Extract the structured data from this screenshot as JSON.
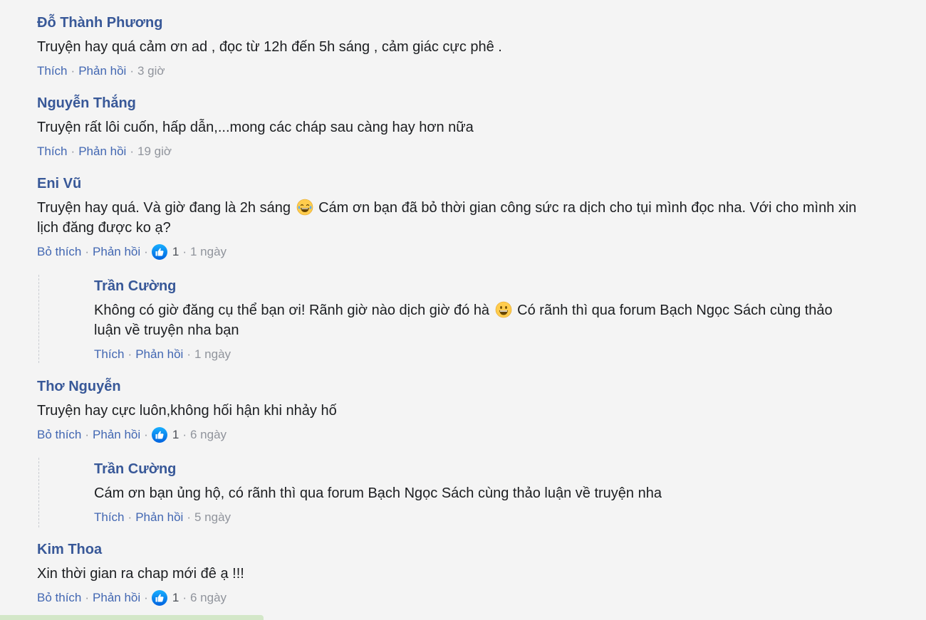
{
  "comments": [
    {
      "author": "Đỗ Thành Phương",
      "text": "Truyện hay quá cảm ơn ad , đọc từ 12h đến 5h sáng , cảm giác cực phê .",
      "like_label": "Thích",
      "reply_label": "Phản hồi",
      "time": "3 giờ"
    },
    {
      "author": "Nguyễn Thắng",
      "text": "Truyện rất lôi cuốn, hấp dẫn,...mong các cháp sau càng hay hơn nữa",
      "like_label": "Thích",
      "reply_label": "Phản hồi",
      "time": "19 giờ"
    },
    {
      "author": "Eni Vũ",
      "text_before_emoji": "Truyện hay quá. Và giờ đang là 2h sáng ",
      "emoji": "laughing-tears",
      "text_after_emoji": " Cám ơn bạn đã bỏ thời gian công sức ra dịch cho tụi mình đọc nha. Với cho mình xin lịch đăng được ko ạ?",
      "like_label": "Bỏ thích",
      "reply_label": "Phản hồi",
      "like_count": "1",
      "time": "1 ngày",
      "reply": {
        "author": "Trần Cường",
        "text_before_emoji": "Không có giờ đăng cụ thể bạn ơi! Rãnh giờ nào dịch giờ đó hà ",
        "emoji": "grinning",
        "text_after_emoji": " Có rãnh thì qua forum Bạch Ngọc Sách cùng thảo luận về truyện nha bạn",
        "like_label": "Thích",
        "reply_label": "Phản hồi",
        "time": "1 ngày"
      }
    },
    {
      "author": "Thơ Nguyễn",
      "text": "Truyện hay cực luôn,không hối hận khi nhảy hố",
      "like_label": "Bỏ thích",
      "reply_label": "Phản hồi",
      "like_count": "1",
      "time": "6 ngày",
      "reply": {
        "author": "Trần Cường",
        "text": "Cám ơn bạn ủng hộ, có rãnh thì qua forum Bạch Ngọc Sách cùng thảo luận về truyện nha",
        "like_label": "Thích",
        "reply_label": "Phản hồi",
        "time": "5 ngày"
      }
    },
    {
      "author": "Kim Thoa",
      "text": "Xin thời gian ra chap mới đê ạ !!!",
      "like_label": "Bỏ thích",
      "reply_label": "Phản hồi",
      "like_count": "1",
      "time": "6 ngày"
    }
  ],
  "separator": "·",
  "colors": {
    "author": "#385898",
    "link": "#4267b2",
    "meta": "#90949c",
    "background": "#f4f4f4",
    "like_badge": "#1877f2"
  }
}
